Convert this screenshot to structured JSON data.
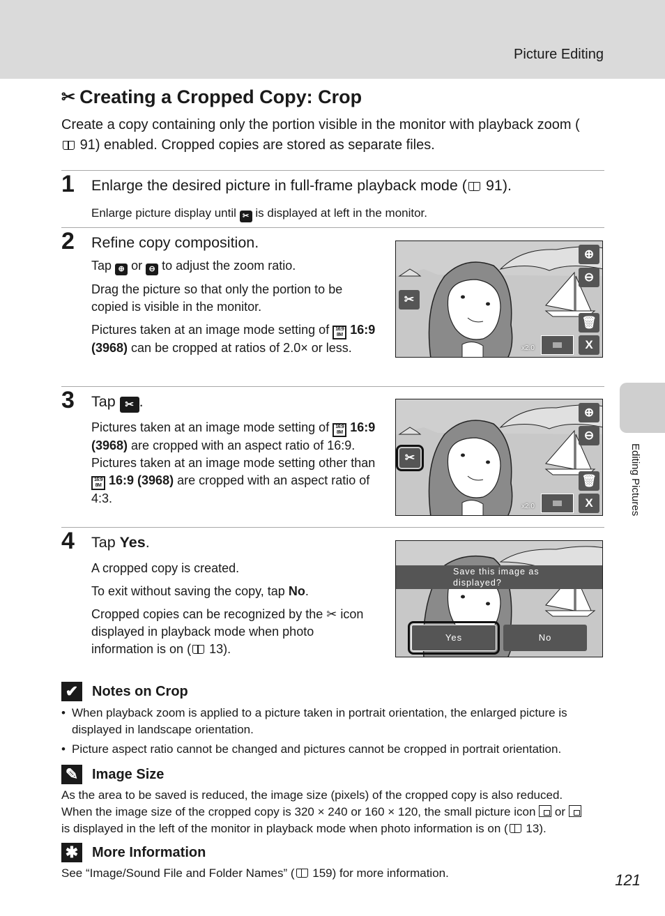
{
  "header": {
    "section_title": "Picture Editing"
  },
  "side_tab": {
    "label": "Editing Pictures"
  },
  "page": {
    "title": "Creating a Cropped Copy: Crop",
    "title_icon": "crop-scissors-icon",
    "intro_part1": "Create a copy containing only the portion visible in the monitor with playback zoom (",
    "intro_ref": "91",
    "intro_part2": ") enabled. Cropped copies are stored as separate files.",
    "page_number": "121"
  },
  "steps": [
    {
      "number": "1",
      "title_part1": "Enlarge the desired picture in full-frame playback mode (",
      "title_ref": "91",
      "title_part2": ").",
      "text_part1": "Enlarge picture display until",
      "text_part2": "is displayed at left in the monitor."
    },
    {
      "number": "2",
      "title": "Refine copy composition.",
      "p1_part1": "Tap",
      "p1_or": "or",
      "p1_part2": "to adjust the zoom ratio.",
      "p2": "Drag the picture so that only the portion to be copied is visible in the monitor.",
      "p3_part1": "Pictures taken at an image mode setting of",
      "p3_bold": "16:9 (3968)",
      "p3_part2": "can be cropped at ratios of 2.0× or less."
    },
    {
      "number": "3",
      "title": "Tap",
      "p1_part1": "Pictures taken at an image mode setting of",
      "p1_bold": "16:9 (3968)",
      "p1_part2": "are cropped with an aspect ratio of 16:9. Pictures taken at an image mode setting other than",
      "p1_bold2": "16:9 (3968)",
      "p1_part3": "are cropped with an aspect ratio of 4:3."
    },
    {
      "number": "4",
      "title_part1": "Tap",
      "title_bold": "Yes",
      "title_part2": ".",
      "p1": "A cropped copy is created.",
      "p2_part1": "To exit without saving the copy, tap",
      "p2_bold": "No",
      "p2_part2": ".",
      "p3_part1": "Cropped copies can be recognized by the",
      "p3_part2": "icon displayed in playback mode when photo information is on (",
      "p3_ref": "13",
      "p3_part3": ")."
    }
  ],
  "icons": {
    "mode_icon_top": "16:9",
    "mode_icon_bottom": "8M",
    "scissors_glyph": "✂",
    "zoom_in_glyph": "⊕",
    "zoom_out_glyph": "⊖",
    "trash_glyph": "🗑",
    "close_glyph": "X",
    "check_glyph": "✔",
    "pencil_glyph": "✎",
    "bulb_glyph": "✱"
  },
  "screens": {
    "zoom_ratio": "x2.0",
    "dialog_question": "Save this image as displayed?",
    "dialog_line1": "Save this image as",
    "dialog_line2": "displayed?",
    "yes_label": "Yes",
    "no_label": "No"
  },
  "notes": {
    "crop": {
      "title": "Notes on Crop",
      "items": [
        "When playback zoom is applied to a picture taken in portrait orientation, the enlarged picture is displayed in landscape orientation.",
        "Picture aspect ratio cannot be changed and pictures cannot be cropped in portrait orientation."
      ]
    },
    "image_size": {
      "title": "Image Size",
      "line1": "As the area to be saved is reduced, the image size (pixels) of the cropped copy is also reduced.",
      "line2_part1": "When the image size of the cropped copy is 320 × 240 or 160 × 120, the small picture icon",
      "line2_or": "or",
      "line3_part1": "is displayed in the left of the monitor in playback mode when photo information is on (",
      "line3_ref": "13",
      "line3_part2": ")."
    },
    "more_info": {
      "title": "More Information",
      "text_part1": "See “Image/Sound File and Folder Names” (",
      "text_ref": "159",
      "text_part2": ") for more information."
    }
  }
}
